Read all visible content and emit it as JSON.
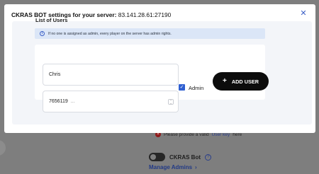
{
  "background": {
    "warning_text": "Please provide a valid",
    "warning_link": "User key",
    "warning_suffix": "here",
    "bot_toggle_label": "CKRAS Bot",
    "help_icon": "question-icon",
    "manage_admins_label": "Manage Admins"
  },
  "modal": {
    "title_bold": "CKRAS BOT settings for your server:",
    "title_server": "83.141.28.61:27190",
    "close_icon": "close-icon",
    "section_title": "List of Users",
    "info_text": "If no one is assigned as admin, every player on the server has admin rights.",
    "name_value": "Chris",
    "id_value": "7656119",
    "id_suffix": "...",
    "admin_checked": true,
    "admin_label": "Admin",
    "add_user_label": "ADD USER"
  },
  "colors": {
    "accent": "#3b5fc6",
    "button_bg": "#0c0c0c",
    "info_bg": "#dbe6f7",
    "overlay": "#7f7f7f"
  }
}
